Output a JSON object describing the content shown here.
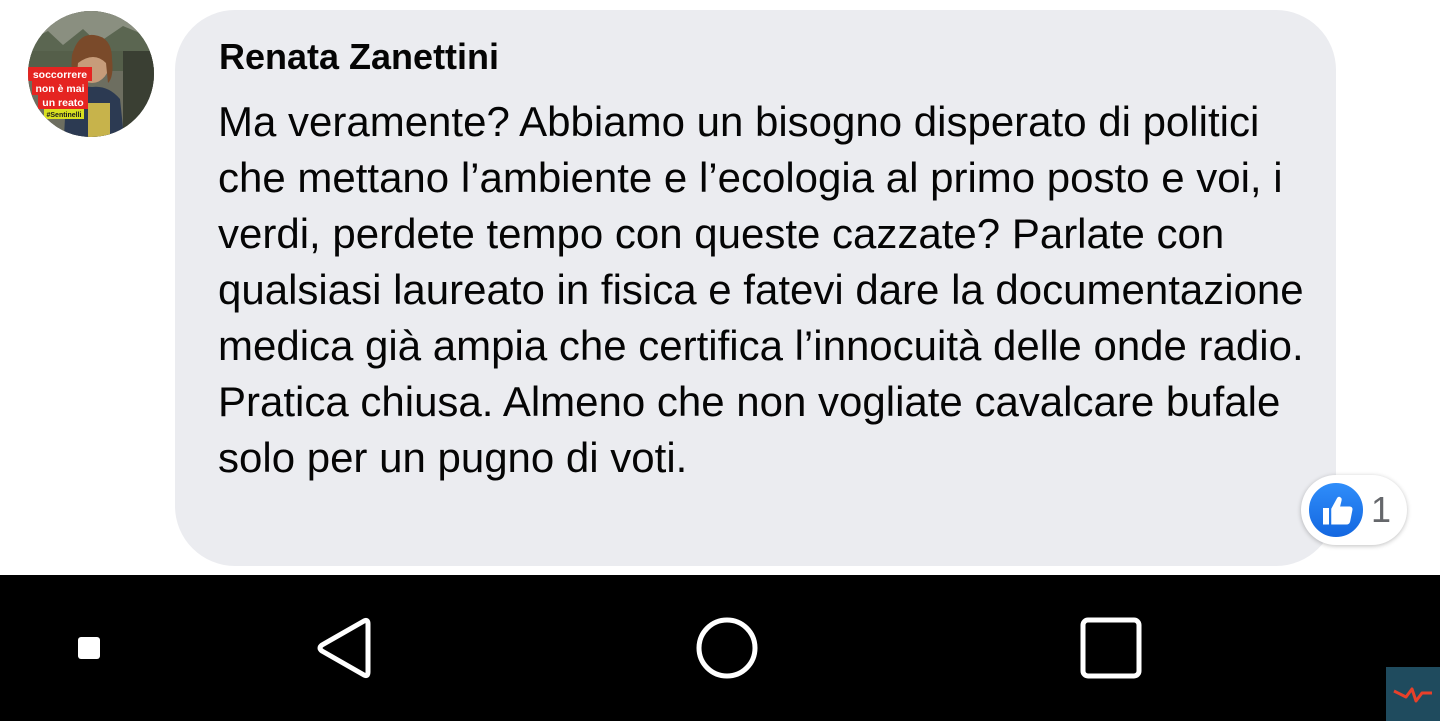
{
  "comment": {
    "author": "Renata Zanettini",
    "text": "Ma veramente? Abbiamo un bisogno disperato di politici che mettano l’ambiente e l’ecologia al primo posto e voi, i verdi, perdete tempo con queste cazzate? Parlate con qualsiasi laureato in fisica e fatevi dare la documentazione medica già ampia che certifica l’innocuità delle onde radio. Pratica chiusa. Almeno che non vogliate cavalcare bufale solo per un pugno di voti.",
    "avatar_overlay": [
      "soccorrere",
      "non è mai",
      "un reato",
      "#Sentinelli"
    ]
  },
  "reactions": {
    "icon": "like-icon",
    "count": "1"
  },
  "nav_bar": {
    "buttons": [
      "menu-icon",
      "back-icon",
      "home-icon",
      "recent-apps-icon"
    ]
  },
  "colors": {
    "bubble": "#ebecf0",
    "text": "#050505",
    "like_blue": "#1877f2",
    "count_gray": "#65676b",
    "nav_bg": "#000000"
  }
}
